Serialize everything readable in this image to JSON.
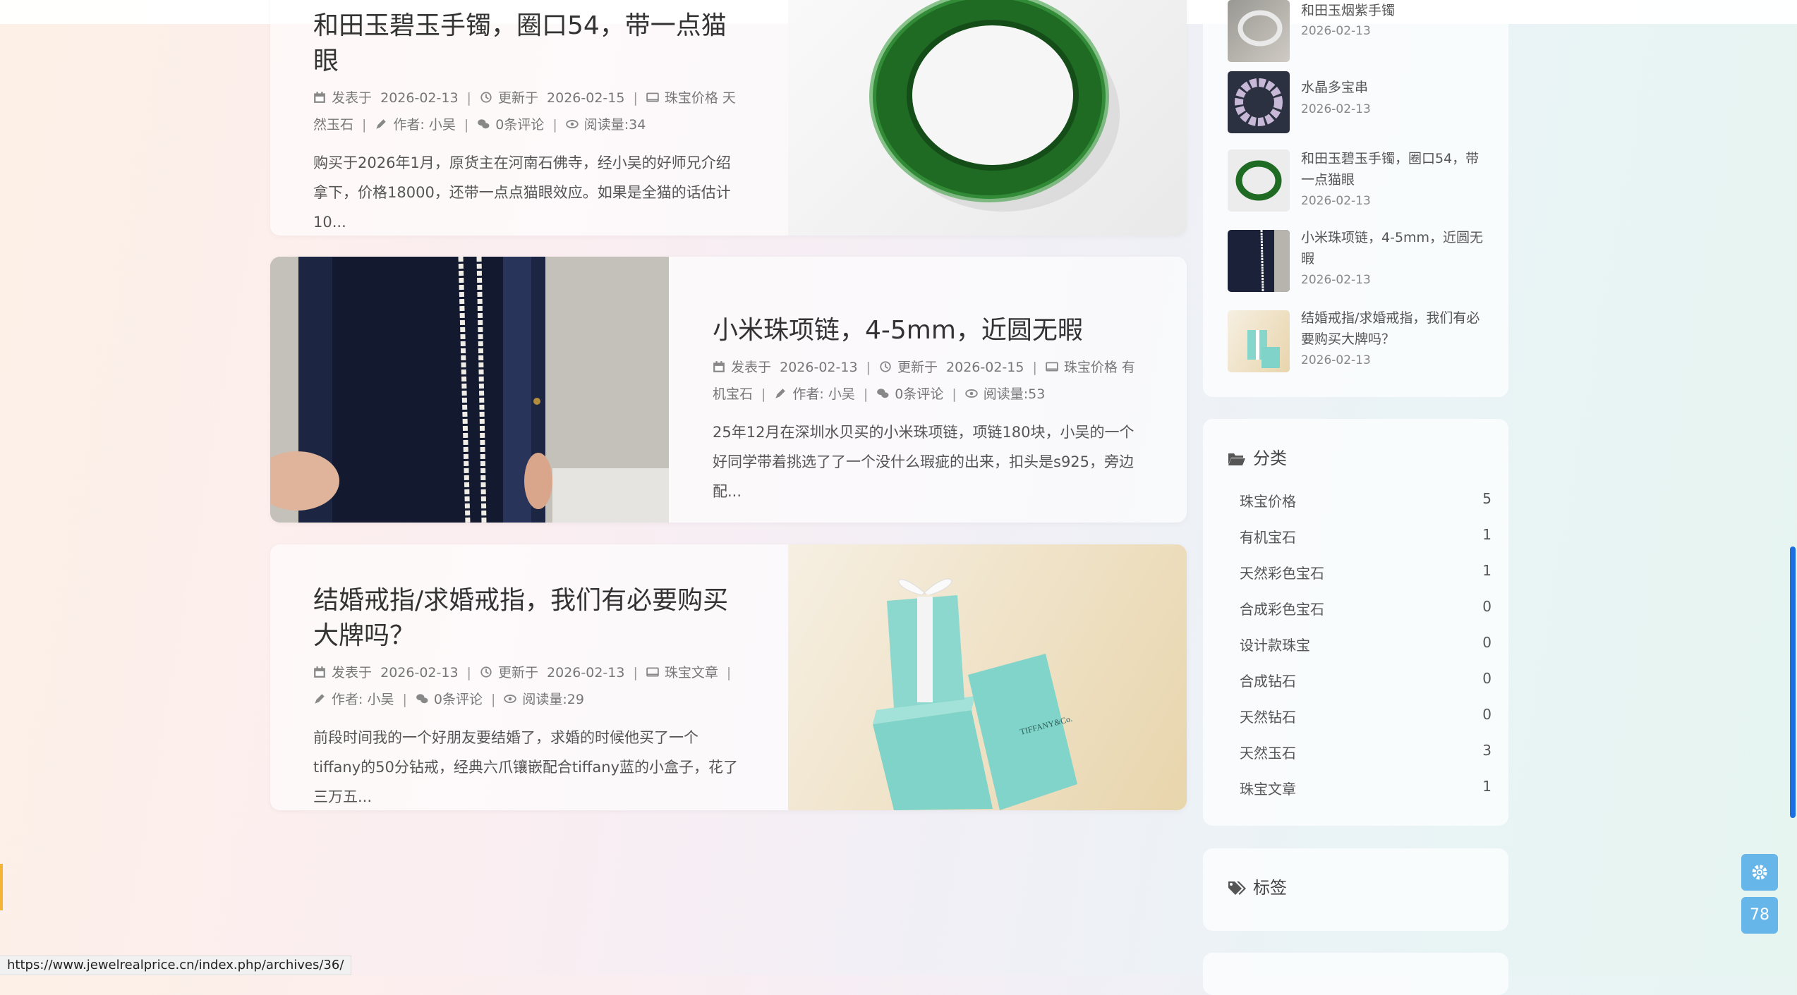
{
  "posts": [
    {
      "title": "和田玉碧玉手镯，圈口54，带一点猫眼",
      "published_label": "发表于",
      "published": "2026-02-13",
      "updated_label": "更新于",
      "updated": "2026-02-15",
      "categories": "珠宝价格 天然玉石",
      "author": "作者: 小吴",
      "comments": "0条评论",
      "views": "阅读量:34",
      "excerpt": "购买于2026年1月，原货主在河南石佛寺，经小吴的好师兄介绍拿下，价格18000，还带一点点猫眼效应。如果是全猫的话估计10..."
    },
    {
      "title": "小米珠项链，4-5mm，近圆无暇",
      "published_label": "发表于",
      "published": "2026-02-13",
      "updated_label": "更新于",
      "updated": "2026-02-15",
      "categories": "珠宝价格 有机宝石",
      "author": "作者: 小吴",
      "comments": "0条评论",
      "views": "阅读量:53",
      "excerpt": "25年12月在深圳水贝买的小米珠项链，项链180块，小吴的一个好同学带着挑选了了一个没什么瑕疵的出来，扣头是s925，旁边配..."
    },
    {
      "title": "结婚戒指/求婚戒指，我们有必要购买大牌吗？",
      "published_label": "发表于",
      "published": "2026-02-13",
      "updated_label": "更新于",
      "updated": "2026-02-13",
      "categories": "珠宝文章",
      "author": "作者: 小吴",
      "comments": "0条评论",
      "views": "阅读量:29",
      "excerpt": "前段时间我的一个好朋友要结婚了，求婚的时候他买了一个tiffany的50分钻戒，经典六爪镶嵌配合tiffany蓝的小盒子，花了三万五...",
      "box_brand": "TIFFANY&Co."
    }
  ],
  "recent": [
    {
      "title": "和田玉烟紫手镯",
      "date": "2026-02-13"
    },
    {
      "title": "水晶多宝串",
      "date": "2026-02-13"
    },
    {
      "title": "和田玉碧玉手镯，圈口54，带一点猫眼",
      "date": "2026-02-13"
    },
    {
      "title": "小米珠项链，4-5mm，近圆无暇",
      "date": "2026-02-13"
    },
    {
      "title": "结婚戒指/求婚戒指，我们有必要购买大牌吗？",
      "date": "2026-02-13"
    }
  ],
  "categories_widget": {
    "title": "分类",
    "items": [
      {
        "name": "珠宝价格",
        "count": "5"
      },
      {
        "name": "有机宝石",
        "count": "1"
      },
      {
        "name": "天然彩色宝石",
        "count": "1"
      },
      {
        "name": "合成彩色宝石",
        "count": "0"
      },
      {
        "name": "设计款珠宝",
        "count": "0"
      },
      {
        "name": "合成钻石",
        "count": "0"
      },
      {
        "name": "天然钻石",
        "count": "0"
      },
      {
        "name": "天然玉石",
        "count": "3"
      },
      {
        "name": "珠宝文章",
        "count": "1"
      }
    ]
  },
  "tags_widget": {
    "title": "标签"
  },
  "status_url": "https://www.jewelrealprice.cn/index.php/archives/36/",
  "fab": {
    "settings_icon": "gear-icon",
    "counter": "78"
  },
  "colors": {
    "accent": "#67b6ea",
    "scrollbar": "#1b6fe0",
    "side_tab": "#f3b533"
  }
}
